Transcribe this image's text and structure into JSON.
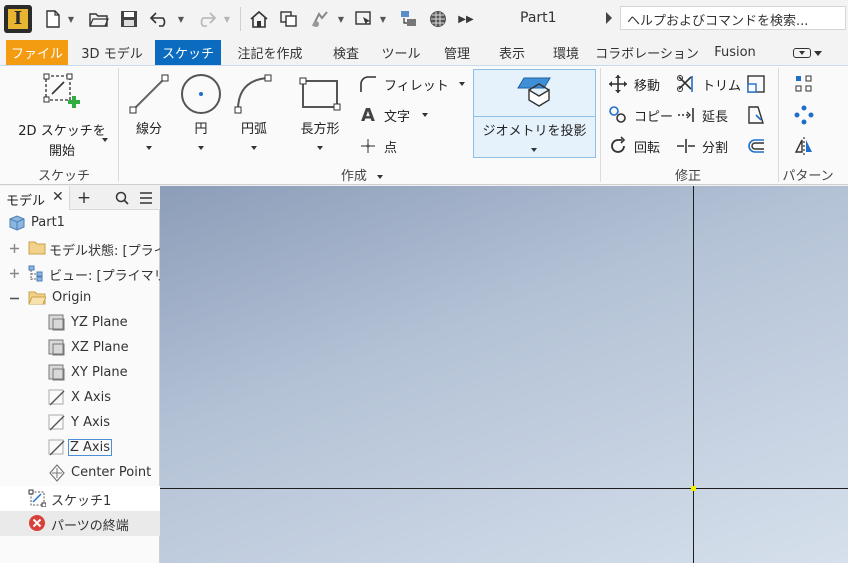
{
  "app": {
    "logo_letter": "I",
    "document_title": "Part1"
  },
  "search": {
    "value": "ヘルプおよびコマンドを検索..."
  },
  "tabs": [
    {
      "label": "ファイル"
    },
    {
      "label": "3D モデル"
    },
    {
      "label": "スケッチ"
    },
    {
      "label": "注記を作成"
    },
    {
      "label": "検査"
    },
    {
      "label": "ツール"
    },
    {
      "label": "管理"
    },
    {
      "label": "表示"
    },
    {
      "label": "環境"
    },
    {
      "label": "コラボレーション"
    },
    {
      "label": "Fusion"
    }
  ],
  "ribbon": {
    "sketch_group": {
      "label": "スケッチ",
      "start_2d_line1": "2D スケッチを",
      "start_2d_line2": "開始"
    },
    "create_group": {
      "label": "作成",
      "line": "線分",
      "circle": "円",
      "arc": "円弧",
      "rectangle": "長方形",
      "fillet": "フィレット",
      "text": "文字",
      "point": "点",
      "project_geometry": "ジオメトリを投影"
    },
    "modify_group": {
      "label": "修正",
      "move": "移動",
      "trim": "トリム",
      "copy": "コピー",
      "extend": "延長",
      "rotate": "回転",
      "split": "分割"
    },
    "pattern_group": {
      "label": "パターン"
    }
  },
  "browser": {
    "tab_label": "モデル",
    "items": [
      {
        "label": "Part1"
      },
      {
        "label": "モデル状態: [プライ"
      },
      {
        "label": "ビュー: [プライマリ]"
      },
      {
        "label": "Origin"
      },
      {
        "label": "YZ Plane"
      },
      {
        "label": "XZ Plane"
      },
      {
        "label": "XY Plane"
      },
      {
        "label": "X Axis"
      },
      {
        "label": "Y Axis"
      },
      {
        "label": "Z Axis"
      },
      {
        "label": "Center Point"
      },
      {
        "label": "スケッチ1"
      },
      {
        "label": "パーツの終端"
      }
    ]
  },
  "colors": {
    "file_tab": "#f39c12",
    "active_tab": "#0a6bbf",
    "origin_point": "#f0f000"
  }
}
